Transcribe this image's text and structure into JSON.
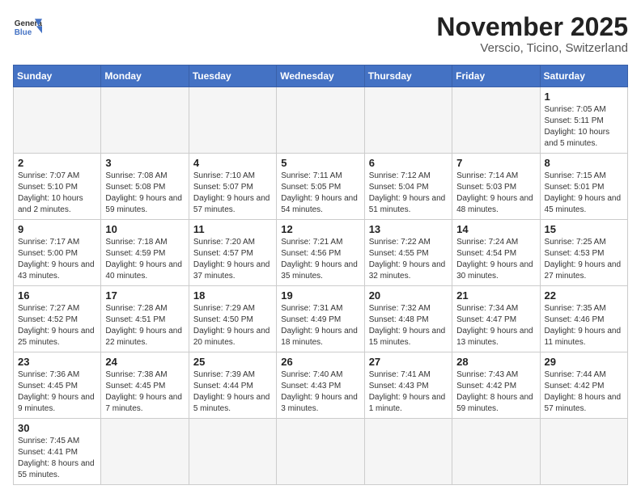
{
  "header": {
    "logo_text_regular": "General",
    "logo_text_bold": "Blue",
    "month_title": "November 2025",
    "location": "Verscio, Ticino, Switzerland"
  },
  "weekdays": [
    "Sunday",
    "Monday",
    "Tuesday",
    "Wednesday",
    "Thursday",
    "Friday",
    "Saturday"
  ],
  "weeks": [
    [
      {
        "day": "",
        "info": ""
      },
      {
        "day": "",
        "info": ""
      },
      {
        "day": "",
        "info": ""
      },
      {
        "day": "",
        "info": ""
      },
      {
        "day": "",
        "info": ""
      },
      {
        "day": "",
        "info": ""
      },
      {
        "day": "1",
        "info": "Sunrise: 7:05 AM\nSunset: 5:11 PM\nDaylight: 10 hours and 5 minutes."
      }
    ],
    [
      {
        "day": "2",
        "info": "Sunrise: 7:07 AM\nSunset: 5:10 PM\nDaylight: 10 hours and 2 minutes."
      },
      {
        "day": "3",
        "info": "Sunrise: 7:08 AM\nSunset: 5:08 PM\nDaylight: 9 hours and 59 minutes."
      },
      {
        "day": "4",
        "info": "Sunrise: 7:10 AM\nSunset: 5:07 PM\nDaylight: 9 hours and 57 minutes."
      },
      {
        "day": "5",
        "info": "Sunrise: 7:11 AM\nSunset: 5:05 PM\nDaylight: 9 hours and 54 minutes."
      },
      {
        "day": "6",
        "info": "Sunrise: 7:12 AM\nSunset: 5:04 PM\nDaylight: 9 hours and 51 minutes."
      },
      {
        "day": "7",
        "info": "Sunrise: 7:14 AM\nSunset: 5:03 PM\nDaylight: 9 hours and 48 minutes."
      },
      {
        "day": "8",
        "info": "Sunrise: 7:15 AM\nSunset: 5:01 PM\nDaylight: 9 hours and 45 minutes."
      }
    ],
    [
      {
        "day": "9",
        "info": "Sunrise: 7:17 AM\nSunset: 5:00 PM\nDaylight: 9 hours and 43 minutes."
      },
      {
        "day": "10",
        "info": "Sunrise: 7:18 AM\nSunset: 4:59 PM\nDaylight: 9 hours and 40 minutes."
      },
      {
        "day": "11",
        "info": "Sunrise: 7:20 AM\nSunset: 4:57 PM\nDaylight: 9 hours and 37 minutes."
      },
      {
        "day": "12",
        "info": "Sunrise: 7:21 AM\nSunset: 4:56 PM\nDaylight: 9 hours and 35 minutes."
      },
      {
        "day": "13",
        "info": "Sunrise: 7:22 AM\nSunset: 4:55 PM\nDaylight: 9 hours and 32 minutes."
      },
      {
        "day": "14",
        "info": "Sunrise: 7:24 AM\nSunset: 4:54 PM\nDaylight: 9 hours and 30 minutes."
      },
      {
        "day": "15",
        "info": "Sunrise: 7:25 AM\nSunset: 4:53 PM\nDaylight: 9 hours and 27 minutes."
      }
    ],
    [
      {
        "day": "16",
        "info": "Sunrise: 7:27 AM\nSunset: 4:52 PM\nDaylight: 9 hours and 25 minutes."
      },
      {
        "day": "17",
        "info": "Sunrise: 7:28 AM\nSunset: 4:51 PM\nDaylight: 9 hours and 22 minutes."
      },
      {
        "day": "18",
        "info": "Sunrise: 7:29 AM\nSunset: 4:50 PM\nDaylight: 9 hours and 20 minutes."
      },
      {
        "day": "19",
        "info": "Sunrise: 7:31 AM\nSunset: 4:49 PM\nDaylight: 9 hours and 18 minutes."
      },
      {
        "day": "20",
        "info": "Sunrise: 7:32 AM\nSunset: 4:48 PM\nDaylight: 9 hours and 15 minutes."
      },
      {
        "day": "21",
        "info": "Sunrise: 7:34 AM\nSunset: 4:47 PM\nDaylight: 9 hours and 13 minutes."
      },
      {
        "day": "22",
        "info": "Sunrise: 7:35 AM\nSunset: 4:46 PM\nDaylight: 9 hours and 11 minutes."
      }
    ],
    [
      {
        "day": "23",
        "info": "Sunrise: 7:36 AM\nSunset: 4:45 PM\nDaylight: 9 hours and 9 minutes."
      },
      {
        "day": "24",
        "info": "Sunrise: 7:38 AM\nSunset: 4:45 PM\nDaylight: 9 hours and 7 minutes."
      },
      {
        "day": "25",
        "info": "Sunrise: 7:39 AM\nSunset: 4:44 PM\nDaylight: 9 hours and 5 minutes."
      },
      {
        "day": "26",
        "info": "Sunrise: 7:40 AM\nSunset: 4:43 PM\nDaylight: 9 hours and 3 minutes."
      },
      {
        "day": "27",
        "info": "Sunrise: 7:41 AM\nSunset: 4:43 PM\nDaylight: 9 hours and 1 minute."
      },
      {
        "day": "28",
        "info": "Sunrise: 7:43 AM\nSunset: 4:42 PM\nDaylight: 8 hours and 59 minutes."
      },
      {
        "day": "29",
        "info": "Sunrise: 7:44 AM\nSunset: 4:42 PM\nDaylight: 8 hours and 57 minutes."
      }
    ],
    [
      {
        "day": "30",
        "info": "Sunrise: 7:45 AM\nSunset: 4:41 PM\nDaylight: 8 hours and 55 minutes."
      },
      {
        "day": "",
        "info": ""
      },
      {
        "day": "",
        "info": ""
      },
      {
        "day": "",
        "info": ""
      },
      {
        "day": "",
        "info": ""
      },
      {
        "day": "",
        "info": ""
      },
      {
        "day": "",
        "info": ""
      }
    ]
  ]
}
